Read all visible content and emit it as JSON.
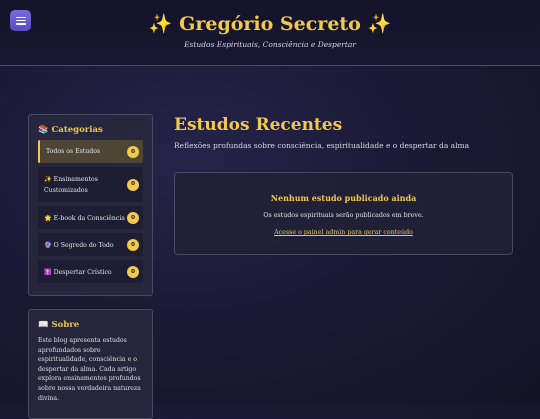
{
  "header": {
    "title": "✨ Gregório Secreto ✨",
    "subtitle": "Estudos Espirituais, Consciência e Despertar"
  },
  "categories": {
    "title": "📚 Categorias",
    "items": [
      {
        "label": "Todos os Estudos",
        "count": "0"
      },
      {
        "label_line1": "✨ Ensinamentos",
        "label_line2": "Customizados",
        "count": "0"
      },
      {
        "label": "🌟 E-book da Consciência",
        "count": "0"
      },
      {
        "label": "🔮 O Segredo do Todo",
        "count": "0"
      },
      {
        "label": "✝️ Despertar Crístico",
        "count": "0"
      }
    ]
  },
  "about": {
    "title": "📖 Sobre",
    "text": "Este blog apresenta estudos aprofundados sobre espiritualidade, consciência e o despertar da alma. Cada artigo explora ensinamentos profundos sobre nossa verdadeira natureza divina."
  },
  "main": {
    "title": "Estudos Recentes",
    "subtitle": "Reflexões profundas sobre consciência, espiritualidade e o despertar da alma",
    "empty": {
      "title": "Nenhum estudo publicado ainda",
      "text": "Os estudos espirituais serão publicados em breve.",
      "link": "Acesse o painel admin para gerar conteúdo"
    }
  },
  "colors": {
    "accent": "#f2c94c",
    "menu_button": "#6a5ad8",
    "background": "#1b1a36"
  }
}
